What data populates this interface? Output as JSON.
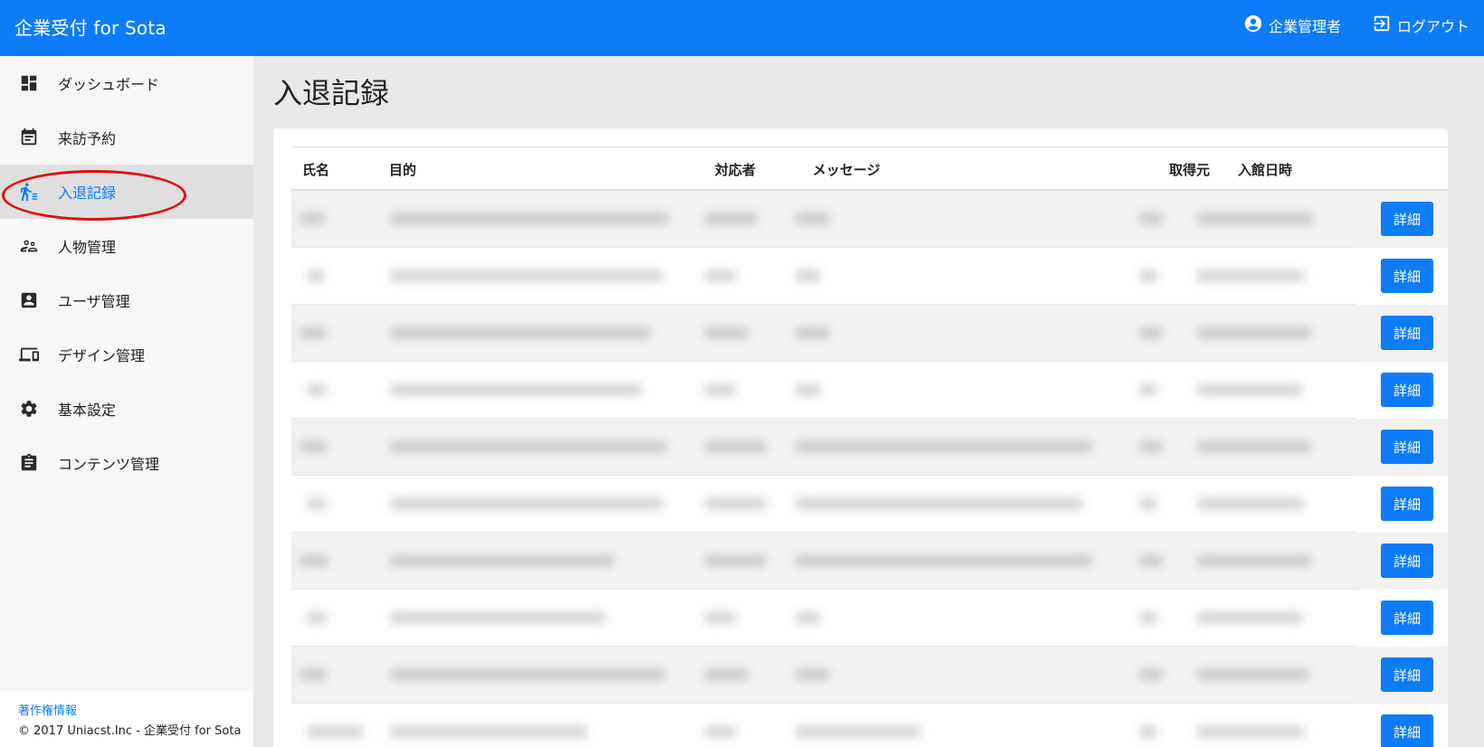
{
  "header": {
    "brand": "企業受付 for Sota",
    "user_label": "企業管理者",
    "logout_label": "ログアウト"
  },
  "sidebar": {
    "items": [
      {
        "label": "ダッシュボード",
        "icon": "dashboard-icon",
        "active": false
      },
      {
        "label": "来訪予約",
        "icon": "calendar-icon",
        "active": false
      },
      {
        "label": "入退記録",
        "icon": "walking-person-icon",
        "active": true
      },
      {
        "label": "人物管理",
        "icon": "people-icon",
        "active": false
      },
      {
        "label": "ユーザ管理",
        "icon": "account-box-icon",
        "active": false
      },
      {
        "label": "デザイン管理",
        "icon": "devices-icon",
        "active": false
      },
      {
        "label": "基本設定",
        "icon": "gear-icon",
        "active": false
      },
      {
        "label": "コンテンツ管理",
        "icon": "clipboard-icon",
        "active": false
      }
    ],
    "footer_link": "著作権情報",
    "footer_copyright": "© 2017 Uniacst.Inc - 企業受付 for Sota"
  },
  "main": {
    "title": "入退記録",
    "table": {
      "columns": [
        "氏名",
        "目的",
        "対応者",
        "メッセージ",
        "取得元",
        "入館日時"
      ],
      "row_button_label": "詳細",
      "row_count": 10
    }
  },
  "colors": {
    "accent": "#0d7cf9",
    "highlight": "#e10f0f"
  }
}
